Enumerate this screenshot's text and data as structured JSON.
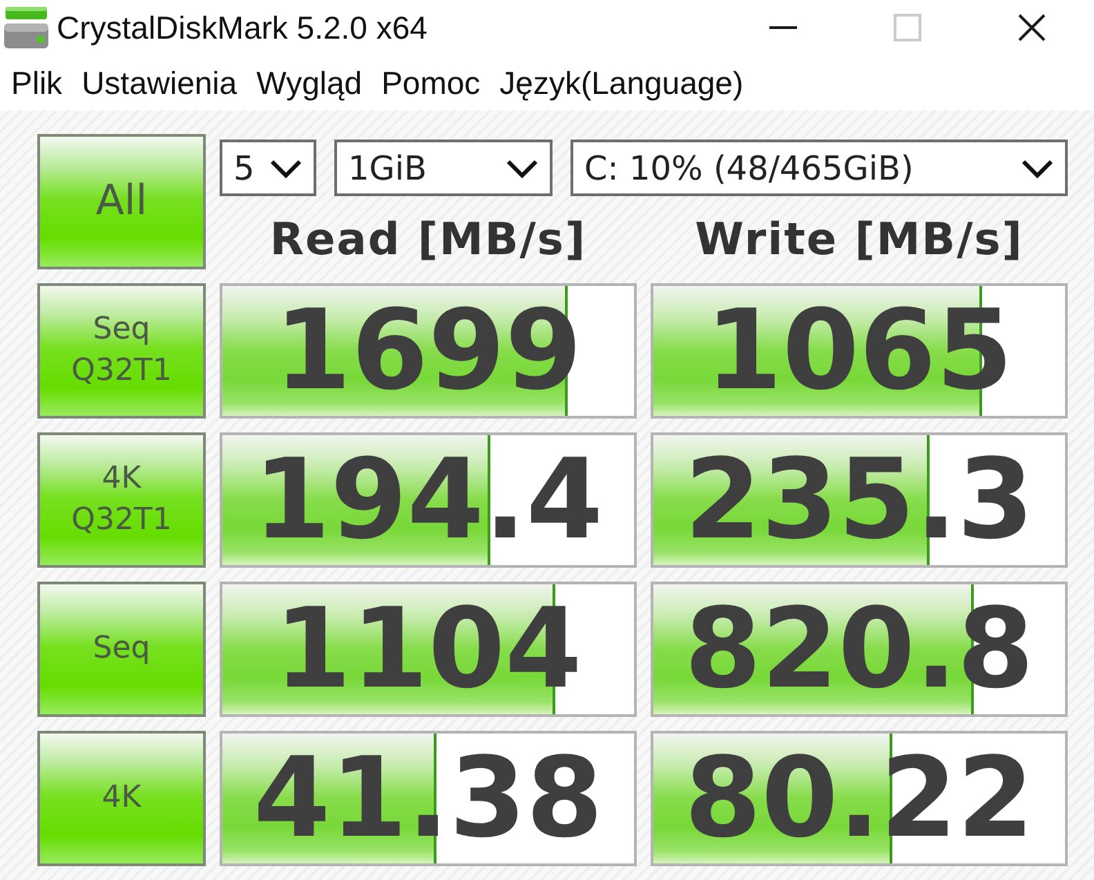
{
  "window": {
    "title": "CrystalDiskMark 5.2.0 x64",
    "controls": [
      {
        "kind": "minimize",
        "disabled": false
      },
      {
        "kind": "maximize",
        "disabled": true
      },
      {
        "kind": "close",
        "disabled": false
      }
    ]
  },
  "menu": [
    "Plik",
    "Ustawienia",
    "Wygląd",
    "Pomoc",
    "Język(Language)"
  ],
  "all_button": "All",
  "selectors": [
    {
      "value": "5"
    },
    {
      "value": "1GiB"
    },
    {
      "value": "C: 10% (48/465GiB)"
    }
  ],
  "columns": [
    "Read [MB/s]",
    "Write [MB/s]"
  ],
  "tests": [
    {
      "label": "Seq Q32T1",
      "read": {
        "value": "1699",
        "level": 0.84
      },
      "write": {
        "value": "1065",
        "level": 0.8
      }
    },
    {
      "label": "4K Q32T1",
      "read": {
        "value": "194.4",
        "level": 0.65
      },
      "write": {
        "value": "235.3",
        "level": 0.67
      }
    },
    {
      "label": "Seq",
      "read": {
        "value": "1104",
        "level": 0.81
      },
      "write": {
        "value": "820.8",
        "level": 0.78
      }
    },
    {
      "label": "4K",
      "read": {
        "value": "41.38",
        "level": 0.52
      },
      "write": {
        "value": "80.22",
        "level": 0.58
      }
    }
  ]
}
